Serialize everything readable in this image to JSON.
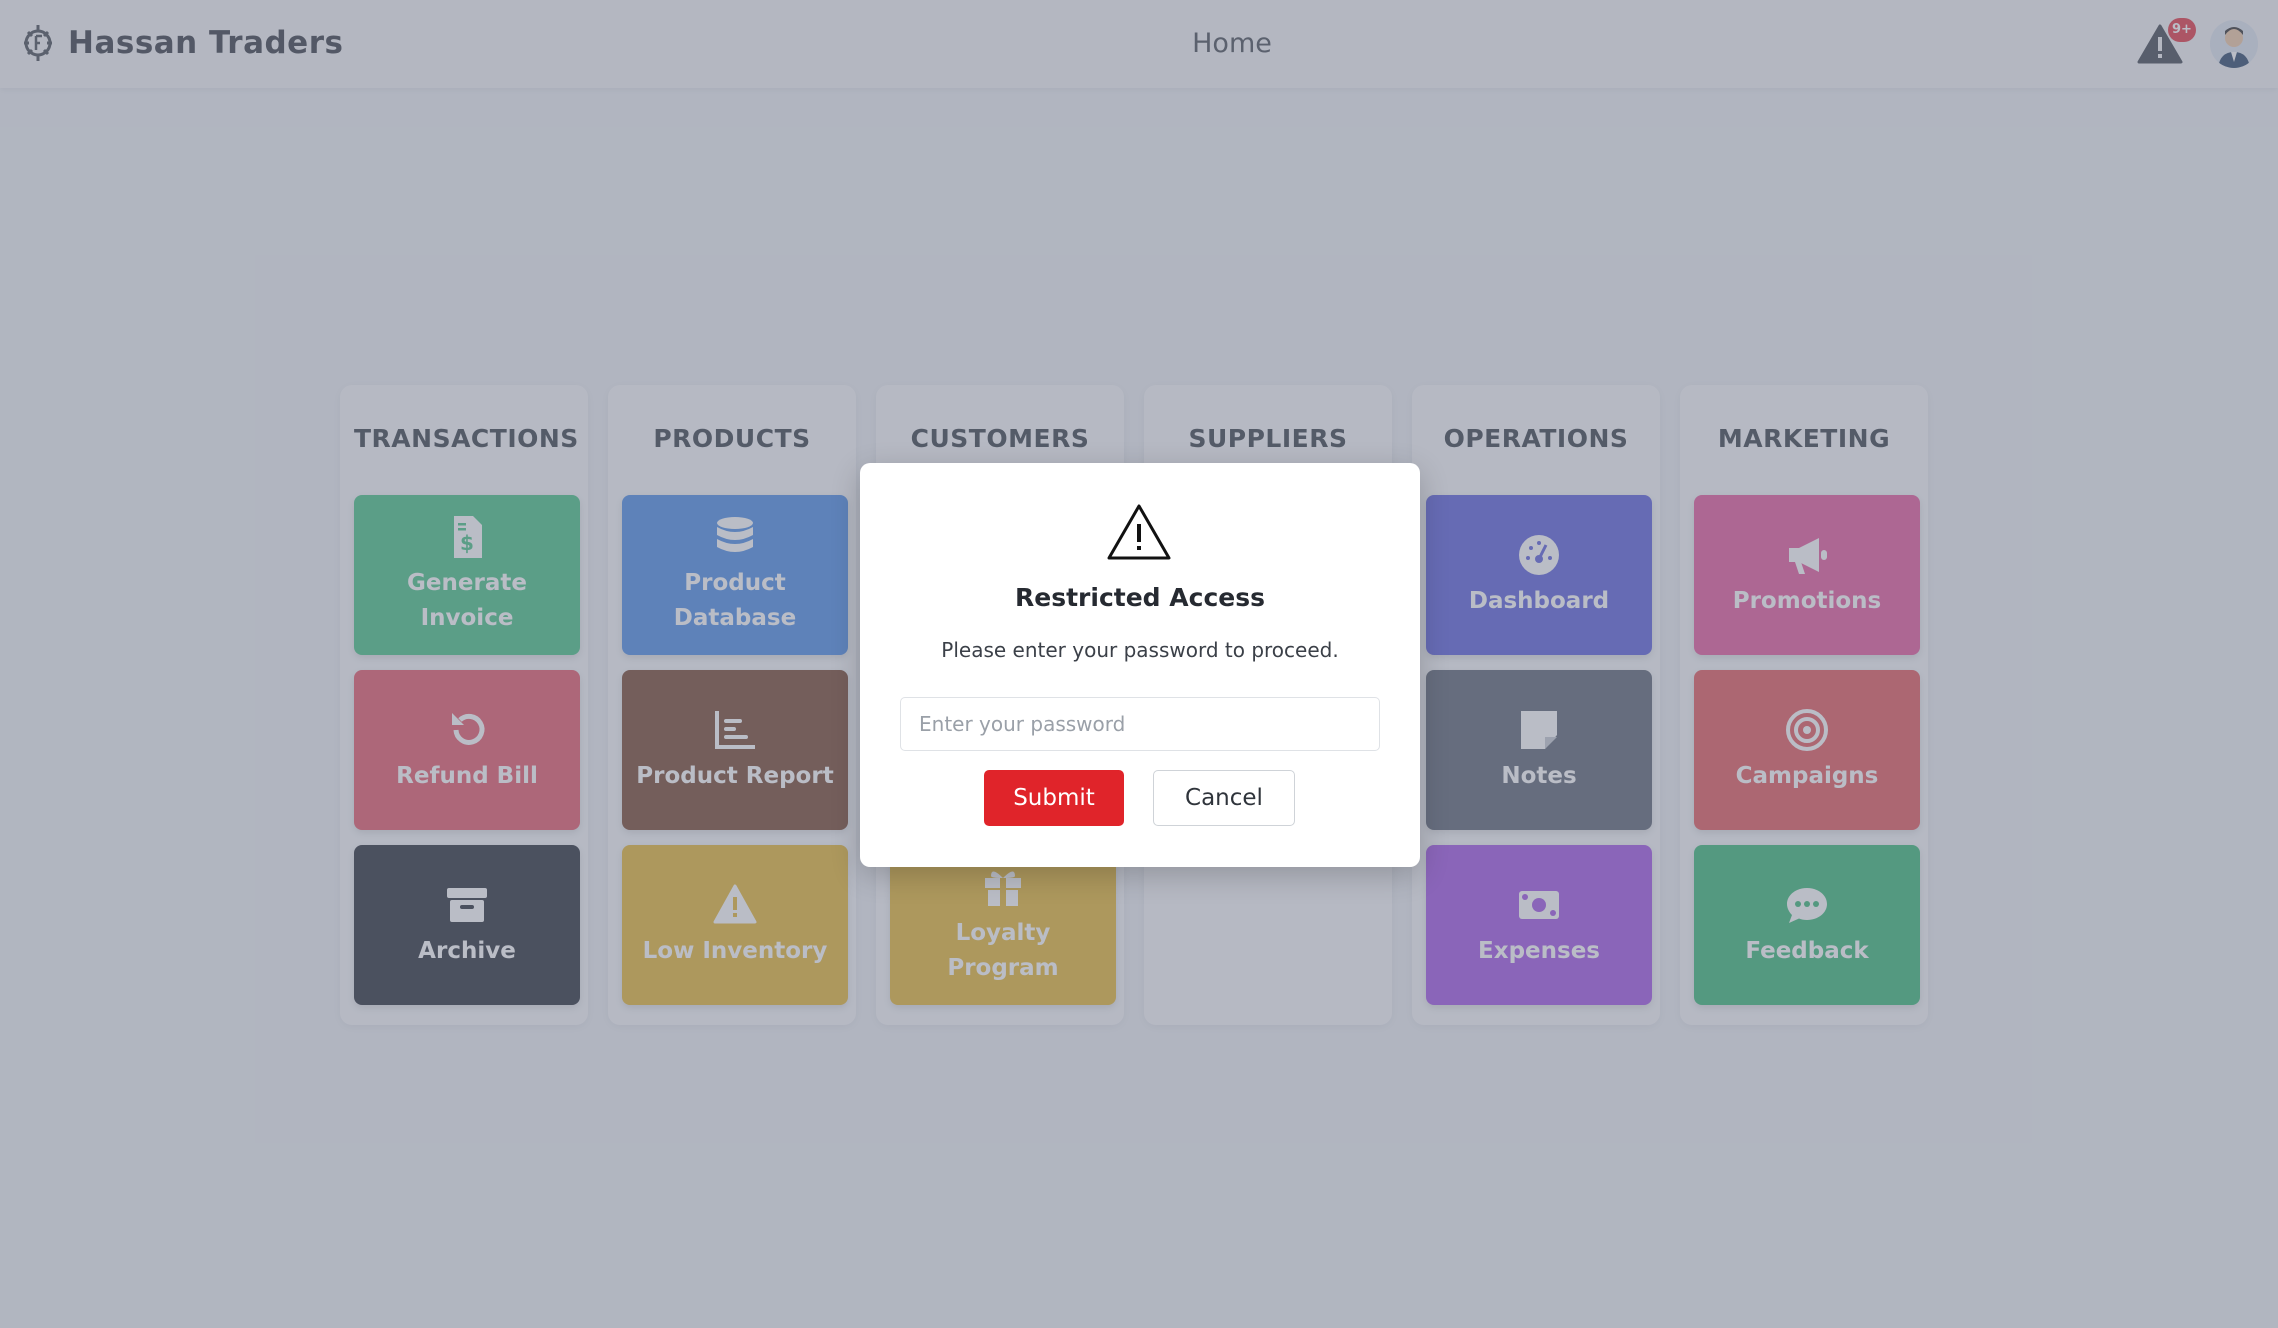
{
  "app": {
    "name": "Hassan Traders",
    "page_title": "Home"
  },
  "header": {
    "notification_badge": "9+",
    "alert_icon": "warning-icon",
    "avatar_icon": "user-avatar"
  },
  "columns": [
    {
      "title": "TRANSACTIONS",
      "tiles": [
        {
          "label": "Generate Invoice",
          "icon": "invoice-icon",
          "color": "#49c486"
        },
        {
          "label": "Refund Bill",
          "icon": "undo-icon",
          "color": "#e65a6b"
        },
        {
          "label": "Archive",
          "icon": "archive-icon",
          "color": "#2b303b"
        }
      ]
    },
    {
      "title": "PRODUCTS",
      "tiles": [
        {
          "label": "Product Database",
          "icon": "database-icon",
          "color": "#4f8fe6"
        },
        {
          "label": "Product Report",
          "icon": "chart-icon",
          "color": "#7a4a33"
        },
        {
          "label": "Low Inventory",
          "icon": "warning-icon",
          "color": "#e6b836"
        }
      ]
    },
    {
      "title": "CUSTOMERS",
      "tiles": [
        {
          "label": "",
          "icon": "",
          "color": "#5b8be0"
        },
        {
          "label": "",
          "icon": "",
          "color": "#1fb5a7"
        },
        {
          "label": "Loyalty Program",
          "icon": "gift-icon",
          "color": "#e6b836"
        }
      ]
    },
    {
      "title": "SUPPLIERS",
      "tiles": []
    },
    {
      "title": "OPERATIONS",
      "tiles": [
        {
          "label": "Dashboard",
          "icon": "gauge-icon",
          "color": "#5f63dd"
        },
        {
          "label": "Notes",
          "icon": "note-icon",
          "color": "#5f6675"
        },
        {
          "label": "Expenses",
          "icon": "money-icon",
          "color": "#a456e6"
        }
      ]
    },
    {
      "title": "MARKETING",
      "tiles": [
        {
          "label": "Promotions",
          "icon": "megaphone-icon",
          "color": "#e65b9d"
        },
        {
          "label": "Campaigns",
          "icon": "target-icon",
          "color": "#e55a5f"
        },
        {
          "label": "Feedback",
          "icon": "chat-icon",
          "color": "#3dbb79"
        }
      ]
    }
  ],
  "modal": {
    "title": "Restricted Access",
    "message": "Please enter your password to proceed.",
    "input_placeholder": "Enter your password",
    "submit_label": "Submit",
    "cancel_label": "Cancel"
  }
}
